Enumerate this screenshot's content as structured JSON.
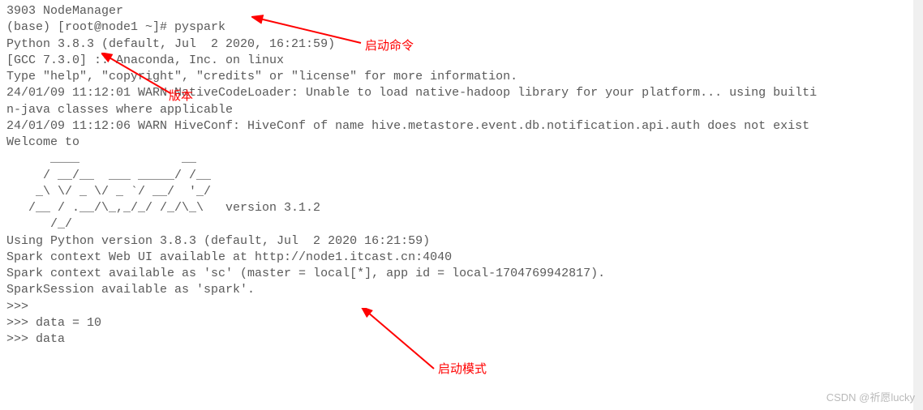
{
  "terminal": {
    "lines": [
      "3903 NodeManager",
      "(base) [root@node1 ~]# pyspark",
      "Python 3.8.3 (default, Jul  2 2020, 16:21:59)",
      "[GCC 7.3.0] :: Anaconda, Inc. on linux",
      "Type \"help\", \"copyright\", \"credits\" or \"license\" for more information.",
      "",
      "24/01/09 11:12:01 WARN NativeCodeLoader: Unable to load native-hadoop library for your platform... using builti",
      "n-java classes where applicable",
      "24/01/09 11:12:06 WARN HiveConf: HiveConf of name hive.metastore.event.db.notification.api.auth does not exist",
      "Welcome to",
      "      ____              __",
      "     / __/__  ___ _____/ /__",
      "    _\\ \\/ _ \\/ _ `/ __/  '_/",
      "   /__ / .__/\\_,_/_/ /_/\\_\\   version 3.1.2",
      "      /_/",
      "",
      "Using Python version 3.8.3 (default, Jul  2 2020 16:21:59)",
      "Spark context Web UI available at http://node1.itcast.cn:4040",
      "Spark context available as 'sc' (master = local[*], app id = local-1704769942817).",
      "SparkSession available as 'spark'.",
      ">>>",
      ">>> data = 10",
      ">>> data"
    ]
  },
  "annotations": {
    "start_command": "启动命令",
    "version": "版本",
    "start_mode": "启动模式"
  },
  "watermark": "CSDN @祈愿lucky"
}
